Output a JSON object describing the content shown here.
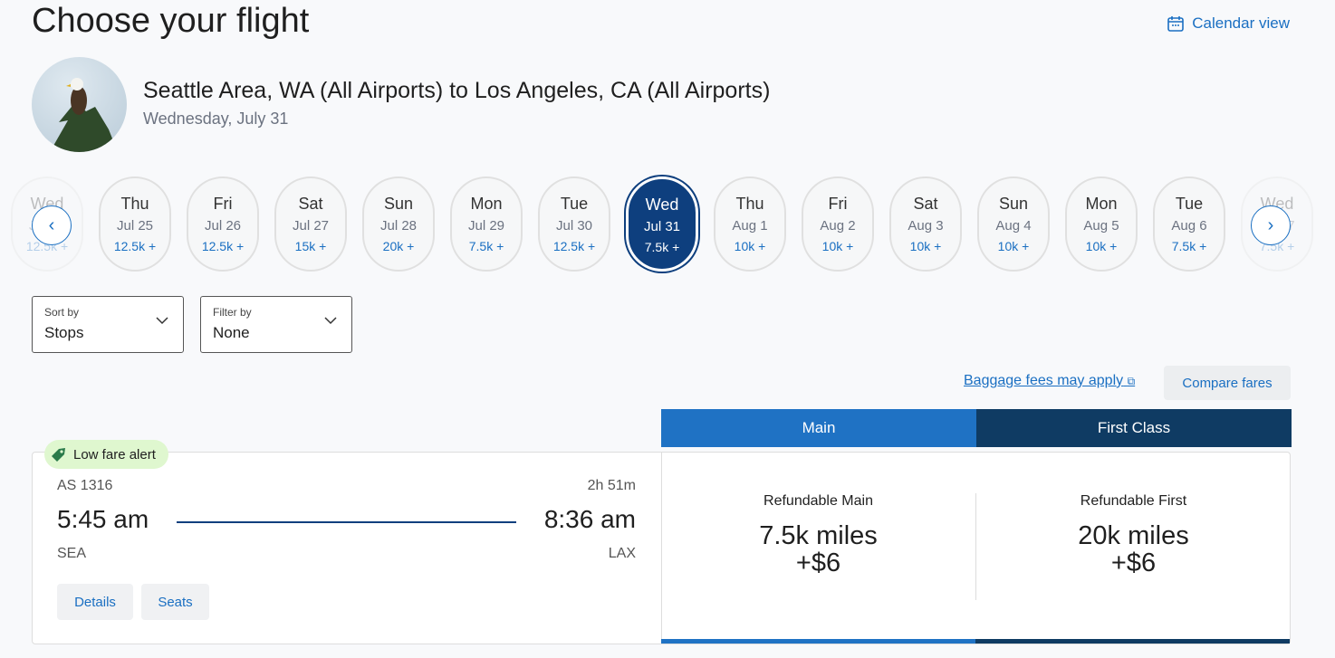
{
  "title": "Choose your flight",
  "calendar_view": "Calendar view",
  "route": "Seattle Area, WA (All Airports) to Los Angeles, CA (All Airports)",
  "date": "Wednesday, July 31",
  "days": [
    {
      "d": "Wed",
      "dt": "Jul 24",
      "p": "12.5k +",
      "state": "faded"
    },
    {
      "d": "Thu",
      "dt": "Jul 25",
      "p": "12.5k +"
    },
    {
      "d": "Fri",
      "dt": "Jul 26",
      "p": "12.5k +"
    },
    {
      "d": "Sat",
      "dt": "Jul 27",
      "p": "15k +"
    },
    {
      "d": "Sun",
      "dt": "Jul 28",
      "p": "20k +"
    },
    {
      "d": "Mon",
      "dt": "Jul 29",
      "p": "7.5k +"
    },
    {
      "d": "Tue",
      "dt": "Jul 30",
      "p": "12.5k +"
    },
    {
      "d": "Wed",
      "dt": "Jul 31",
      "p": "7.5k +",
      "state": "selected"
    },
    {
      "d": "Thu",
      "dt": "Aug 1",
      "p": "10k +"
    },
    {
      "d": "Fri",
      "dt": "Aug 2",
      "p": "10k +"
    },
    {
      "d": "Sat",
      "dt": "Aug 3",
      "p": "10k +"
    },
    {
      "d": "Sun",
      "dt": "Aug 4",
      "p": "10k +"
    },
    {
      "d": "Mon",
      "dt": "Aug 5",
      "p": "10k +"
    },
    {
      "d": "Tue",
      "dt": "Aug 6",
      "p": "7.5k +"
    },
    {
      "d": "Wed",
      "dt": "Aug 7",
      "p": "7.5k +",
      "state": "faded"
    }
  ],
  "sort": {
    "label": "Sort by",
    "value": "Stops"
  },
  "filter": {
    "label": "Filter by",
    "value": "None"
  },
  "baggage": "Baggage fees may apply",
  "compare": "Compare fares",
  "tabs": {
    "main": "Main",
    "first": "First Class"
  },
  "colors": {
    "accent": "#1a6fc2",
    "main_tab": "#1f72c4",
    "first_tab": "#0f3b63",
    "selected_day": "#0e3f7e"
  },
  "flight": {
    "alert": "Low fare alert",
    "number": "AS 1316",
    "duration": "2h 51m",
    "depart": "5:45 am",
    "arrive": "8:36 am",
    "from": "SEA",
    "to": "LAX",
    "details": "Details",
    "seats": "Seats",
    "fares": [
      {
        "name": "Refundable Main",
        "miles": "7.5k miles",
        "tax": "+$6"
      },
      {
        "name": "Refundable First",
        "miles": "20k miles",
        "tax": "+$6"
      }
    ]
  }
}
